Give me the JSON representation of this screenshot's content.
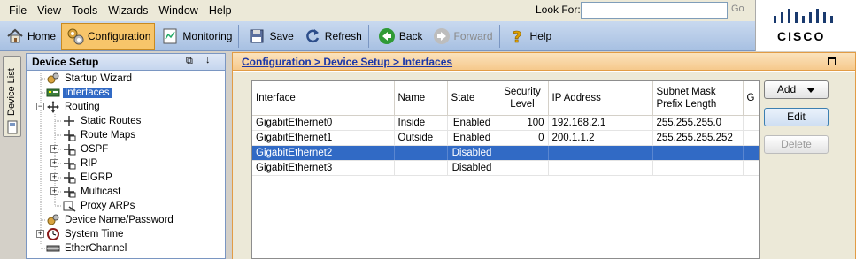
{
  "menu": [
    "File",
    "View",
    "Tools",
    "Wizards",
    "Window",
    "Help"
  ],
  "search": {
    "label": "Look For:",
    "value": "",
    "go": "Go"
  },
  "toolbar": {
    "home": "Home",
    "configuration": "Configuration",
    "monitoring": "Monitoring",
    "save": "Save",
    "refresh": "Refresh",
    "back": "Back",
    "forward": "Forward",
    "help": "Help"
  },
  "logo": {
    "text": "CISCO",
    "color": "#1a3a6e"
  },
  "device_list_tab": "Device List",
  "device_setup": {
    "title": "Device Setup",
    "tree": [
      "Startup Wizard",
      "Interfaces",
      "Routing",
      "Static Routes",
      "Route Maps",
      "OSPF",
      "RIP",
      "EIGRP",
      "Multicast",
      "Proxy ARPs",
      "Device Name/Password",
      "System Time",
      "EtherChannel"
    ]
  },
  "breadcrumb": "Configuration > Device Setup > Interfaces",
  "table": {
    "headers": [
      "Interface",
      "Name",
      "State",
      "Security Level",
      "IP Address",
      "Subnet Mask Prefix Length",
      "G"
    ],
    "rows": [
      [
        "GigabitEthernet0",
        "Inside",
        "Enabled",
        "100",
        "192.168.2.1",
        "255.255.255.0"
      ],
      [
        "GigabitEthernet1",
        "Outside",
        "Enabled",
        "0",
        "200.1.1.2",
        "255.255.255.252"
      ],
      [
        "GigabitEthernet2",
        "",
        "Disabled",
        "",
        "",
        ""
      ],
      [
        "GigabitEthernet3",
        "",
        "Disabled",
        "",
        "",
        ""
      ]
    ],
    "selected_row": 2
  },
  "actions": {
    "add": "Add",
    "edit": "Edit",
    "delete": "Delete"
  },
  "colors": {
    "selection": "#316ac5",
    "toolbar": "#a7c0e2",
    "active_tool": "#f7c56a",
    "panel_border": "#e29c45"
  }
}
